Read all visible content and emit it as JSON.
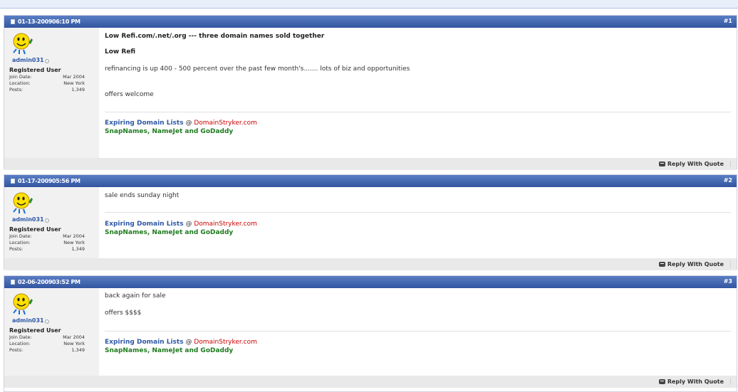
{
  "posts": [
    {
      "date": "01-13-2009",
      "time": "06:10 PM",
      "number": "#1",
      "user": {
        "name": "admin031",
        "title": "Registered User",
        "join_label": "Join Date:",
        "join_value": "Mar 2004",
        "location_label": "Location:",
        "location_value": "New York",
        "posts_label": "Posts:",
        "posts_value": "1,349"
      },
      "title": "Low Refi.com/.net/.org --- three domain names sold together",
      "body": [
        "Low Refi",
        "refinancing is up 400 - 500 percent over the past few month's....... lots of biz and opportunities",
        "offers welcome"
      ],
      "reply_label": "Reply With Quote"
    },
    {
      "date": "01-17-2009",
      "time": "05:56 PM",
      "number": "#2",
      "user": {
        "name": "admin031",
        "title": "Registered User",
        "join_label": "Join Date:",
        "join_value": "Mar 2004",
        "location_label": "Location:",
        "location_value": "New York",
        "posts_label": "Posts:",
        "posts_value": "1,349"
      },
      "body": [
        "sale ends sunday night"
      ],
      "reply_label": "Reply With Quote"
    },
    {
      "date": "02-06-2009",
      "time": "03:52 PM",
      "number": "#3",
      "user": {
        "name": "admin031",
        "title": "Registered User",
        "join_label": "Join Date:",
        "join_value": "Mar 2004",
        "location_label": "Location:",
        "location_value": "New York",
        "posts_label": "Posts:",
        "posts_value": "1,349"
      },
      "body": [
        "back again for sale",
        "offers $$$$"
      ],
      "reply_label": "Reply With Quote"
    }
  ],
  "signature": {
    "link_text": "Expiring Domain Lists",
    "at": "@",
    "site": "DomainStryker.com",
    "line2": "SnapNames, NameJet and GoDaddy"
  },
  "icons": {
    "avatar": "smiley-avatar-icon",
    "post": "post-doc-icon",
    "reply": "quote-bubble-icon",
    "status": "offline-status-icon"
  },
  "colors": {
    "header": "#3e5fa9",
    "username": "#2e58a6",
    "sig_link": "#2e58a6",
    "sig_site": "#cc0000",
    "sig_line2": "#1f7a1f",
    "sidebar": "#f1f1f1",
    "footer": "#e9e9e9"
  }
}
